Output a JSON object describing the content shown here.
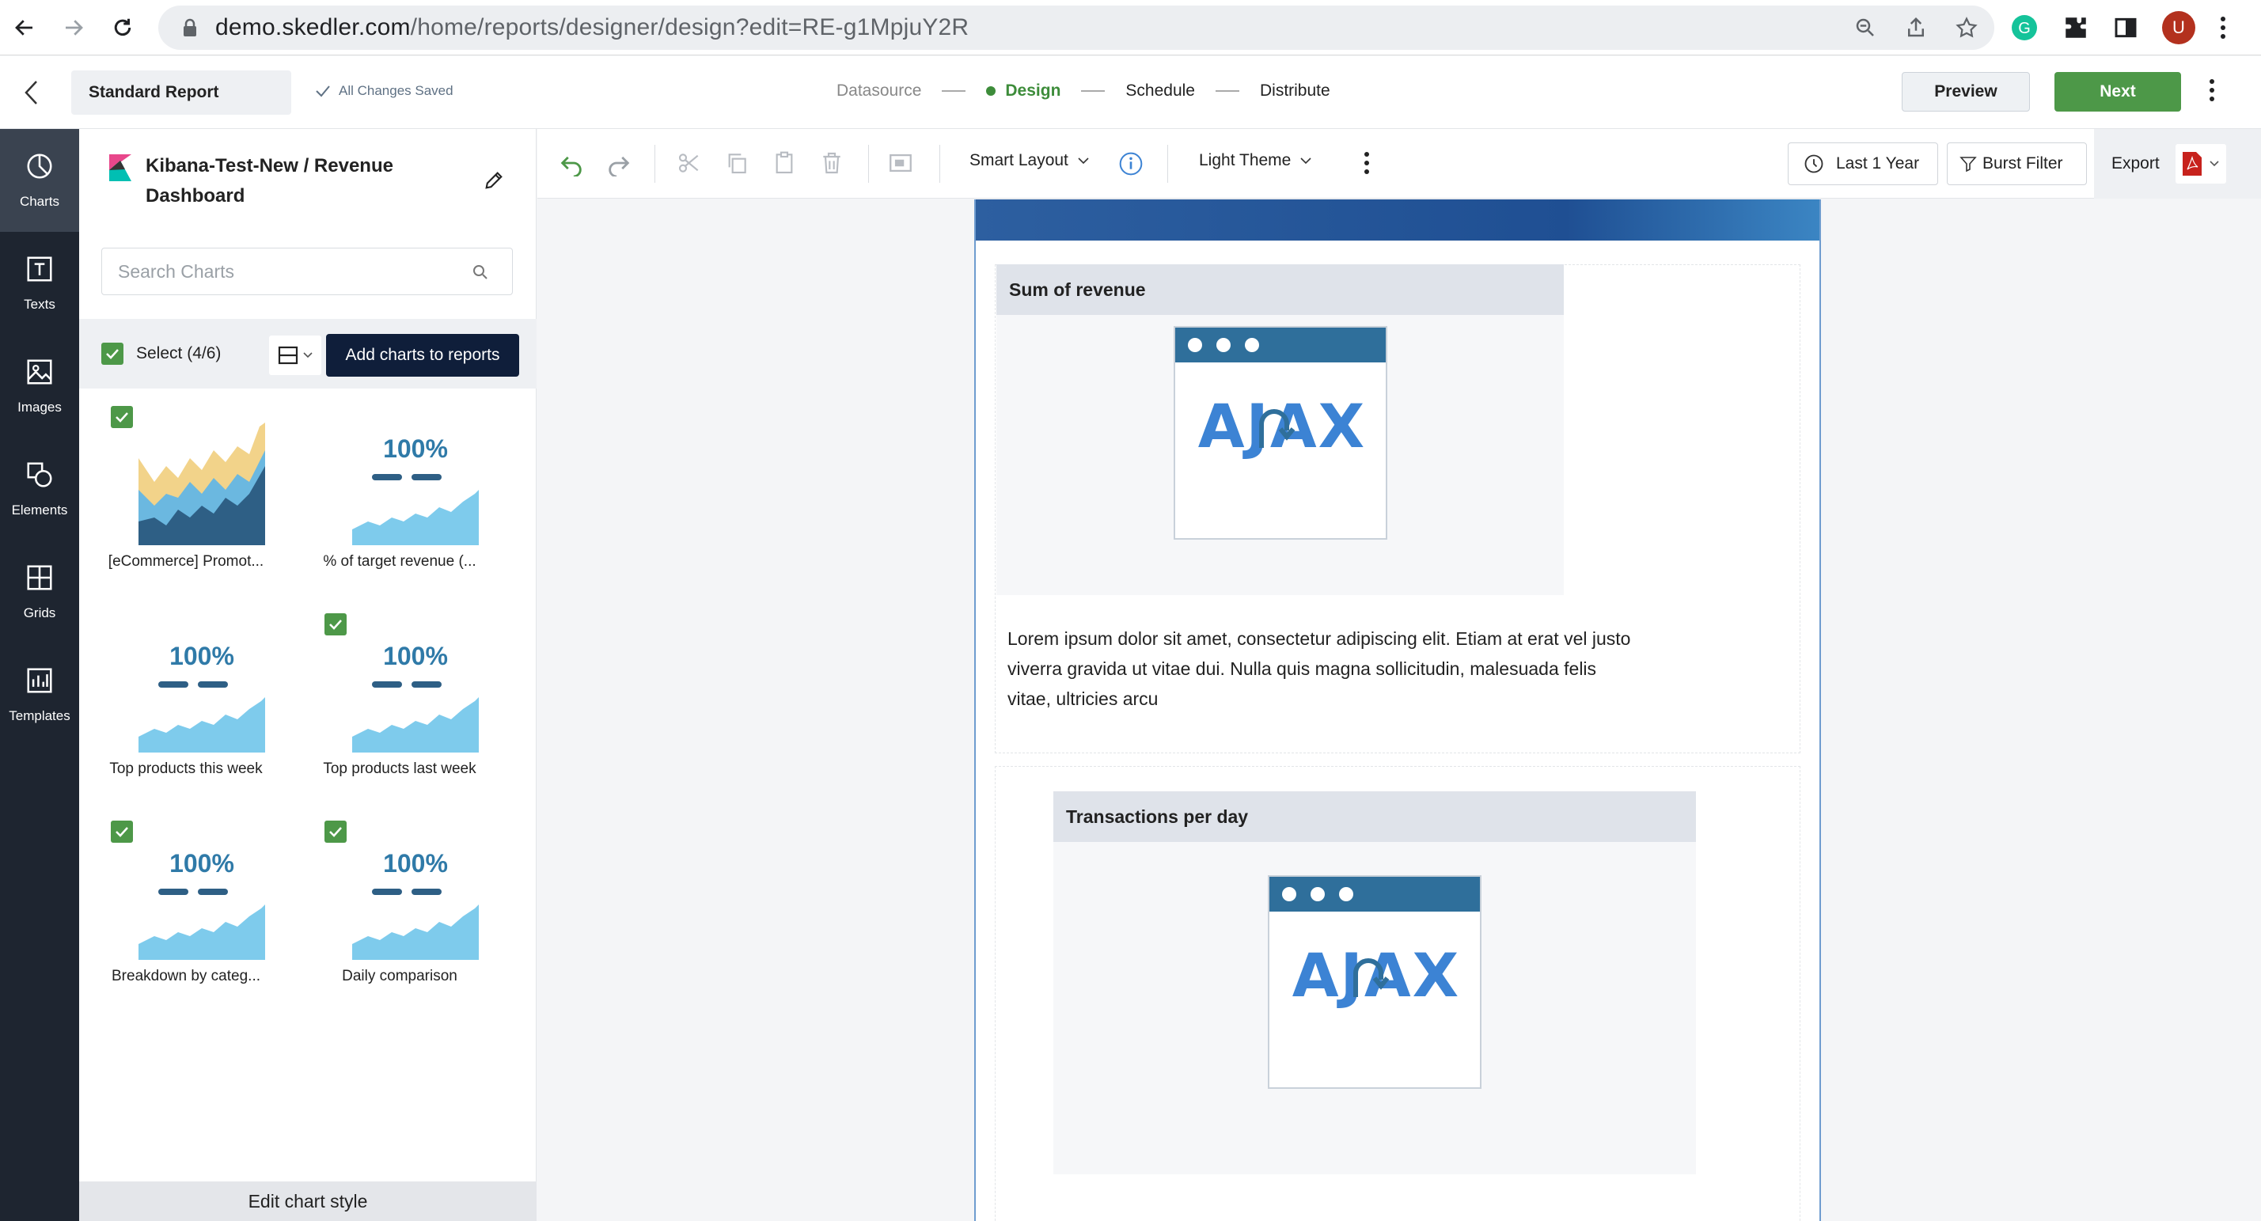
{
  "browser": {
    "url_host": "demo.skedler.com",
    "url_path": "/home/reports/designer/design?edit=RE-g1MpjuY2R",
    "avatar_letter": "U"
  },
  "header": {
    "report_name": "Standard Report",
    "save_status": "All Changes Saved",
    "steps": [
      "Datasource",
      "Design",
      "Schedule",
      "Distribute"
    ],
    "preview_label": "Preview",
    "next_label": "Next"
  },
  "rail": {
    "items": [
      {
        "label": "Charts",
        "icon": "pie-chart-icon"
      },
      {
        "label": "Texts",
        "icon": "text-icon"
      },
      {
        "label": "Images",
        "icon": "image-icon"
      },
      {
        "label": "Elements",
        "icon": "shapes-icon"
      },
      {
        "label": "Grids",
        "icon": "grid-icon"
      },
      {
        "label": "Templates",
        "icon": "template-icon"
      }
    ]
  },
  "panel": {
    "title": "Kibana-Test-New / Revenue Dashboard",
    "search_placeholder": "Search Charts",
    "select_label": "Select (4/6)",
    "add_button": "Add charts to reports",
    "charts": [
      {
        "name": "[eCommerce] Promot...",
        "checked": true,
        "type": "area-stack"
      },
      {
        "name": "% of target revenue (...",
        "checked": false,
        "type": "metric",
        "metric": "100%"
      },
      {
        "name": "Top products this week",
        "checked": false,
        "type": "metric",
        "metric": "100%"
      },
      {
        "name": "Top products last week",
        "checked": true,
        "type": "metric",
        "metric": "100%"
      },
      {
        "name": "Breakdown by categ...",
        "checked": true,
        "type": "metric",
        "metric": "100%"
      },
      {
        "name": "Daily comparison",
        "checked": true,
        "type": "metric",
        "metric": "100%"
      }
    ],
    "footer": "Edit chart style"
  },
  "toolbar": {
    "layout": "Smart Layout",
    "theme": "Light Theme",
    "time_range": "Last 1 Year",
    "burst_filter": "Burst Filter",
    "export": "Export"
  },
  "canvas": {
    "widget1_title": "Sum of revenue",
    "widget1_image_text": "AJAX",
    "lorem": "Lorem ipsum dolor sit amet, consectetur adipiscing elit. Etiam at erat vel justo viverra gravida ut vitae dui. Nulla quis magna sollicitudin, malesuada felis vitae, ultricies arcu",
    "widget2_title": "Transactions per day",
    "widget2_image_text": "AJAX"
  },
  "colors": {
    "accent_green": "#4d9848",
    "navy": "#0f1e3a",
    "rail_bg": "#1e2530",
    "metric_blue": "#2f7aa8",
    "area_light_blue": "#7ecbec"
  }
}
